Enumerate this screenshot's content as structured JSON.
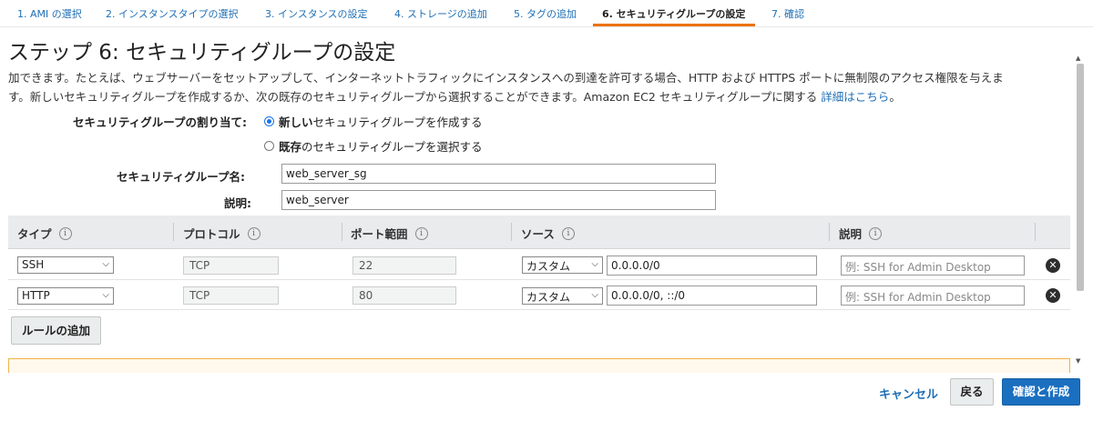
{
  "tabs": [
    {
      "label": "1. AMI の選択",
      "active": false
    },
    {
      "label": "2. インスタンスタイプの選択",
      "active": false
    },
    {
      "label": "3. インスタンスの設定",
      "active": false
    },
    {
      "label": "4. ストレージの追加",
      "active": false
    },
    {
      "label": "5. タグの追加",
      "active": false
    },
    {
      "label": "6. セキュリティグループの設定",
      "active": true
    },
    {
      "label": "7. 確認",
      "active": false
    }
  ],
  "page": {
    "title": "ステップ 6: セキュリティグループの設定",
    "description_line1": "加できます。たとえば、ウェブサーバーをセットアップして、インターネットトラフィックにインスタンスへの到達を許可する場合、HTTP および HTTPS ポートに無制限のアクセス権限を与えま",
    "description_line2": "す。新しいセキュリティグループを作成するか、次の既存のセキュリティグループから選択することができます。Amazon EC2 セキュリティグループに関する",
    "details_link": "詳細はこちら",
    "details_suffix": "。"
  },
  "assignment": {
    "label": "セキュリティグループの割り当て:",
    "option_new_strong": "新しい",
    "option_new_rest": "セキュリティグループを作成する",
    "option_existing_strong": "既存",
    "option_existing_rest": "のセキュリティグループを選択する",
    "selected": "new"
  },
  "group_name": {
    "label": "セキュリティグループ名:",
    "value": "web_server_sg"
  },
  "group_desc": {
    "label": "説明:",
    "value": "web_server"
  },
  "table": {
    "headers": {
      "type": "タイプ",
      "protocol": "プロトコル",
      "port_range": "ポート範囲",
      "source": "ソース",
      "description": "説明"
    },
    "info_glyph": "i",
    "rows": [
      {
        "type": "SSH",
        "protocol": "TCP",
        "port": "22",
        "source_mode": "カスタム",
        "source_value": "0.0.0.0/0",
        "desc_placeholder": "例: SSH for Admin Desktop"
      },
      {
        "type": "HTTP",
        "protocol": "TCP",
        "port": "80",
        "source_mode": "カスタム",
        "source_value": "0.0.0.0/0, ::/0",
        "desc_placeholder": "例: SSH for Admin Desktop"
      }
    ]
  },
  "buttons": {
    "add_rule": "ルールの追加",
    "cancel": "キャンセル",
    "back": "戻る",
    "review_launch": "確認と作成"
  },
  "icons": {
    "caret": "chevron-down-icon",
    "remove": "remove-circle-icon",
    "info": "info-icon"
  },
  "colors": {
    "link": "#1f6fb5",
    "active_tab_underline": "#ec7211",
    "primary_button": "#1b6fbf",
    "warning_border": "#f0b548"
  }
}
